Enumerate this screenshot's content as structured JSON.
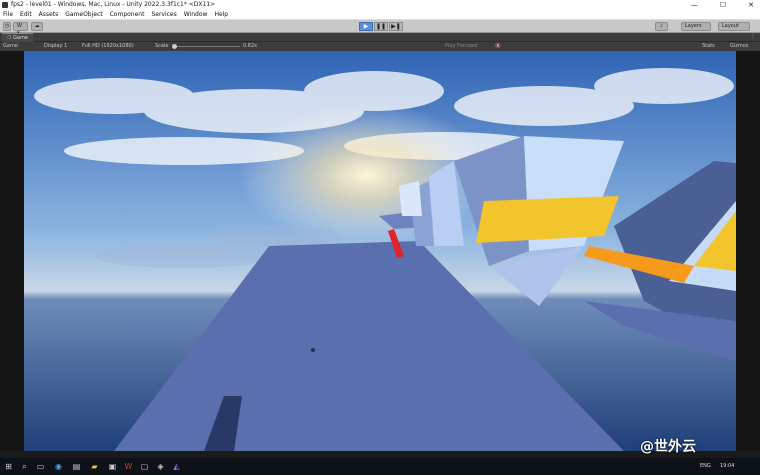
{
  "window": {
    "title": "fps2 - level01 - Windows, Mac, Linux - Unity 2022.3.3f1c1* <DX11>",
    "controls": [
      "—",
      "☐",
      "✕"
    ]
  },
  "menu": [
    "File",
    "Edit",
    "Assets",
    "GameObject",
    "Component",
    "Services",
    "Window",
    "Help"
  ],
  "toolbar": {
    "account_label": "W ▾",
    "cloud_label": "☁",
    "play": "▶",
    "pause": "❚❚",
    "step": "▶❚",
    "layers_label": "Layers",
    "layout_label": "Layout",
    "search_icon": "search-icon"
  },
  "tab": {
    "label": "Game"
  },
  "gamebar": {
    "mode": "Game",
    "display": "Display 1",
    "resolution": "Full HD (1920x1080)",
    "scale_label": "Scale",
    "scale_value": "0.82x",
    "play_focused": "Play Focused",
    "stats": "Stats",
    "gizmos": "Gizmos"
  },
  "taskbar": {
    "lang": "ENG",
    "time": "19:04"
  },
  "watermark": "@世外云",
  "colors": {
    "play_active": "#5b8fd6",
    "sky_top": "#2f63b5",
    "floor": "#5a6fae",
    "yellow_block": "#f2c52c",
    "orange_beam": "#f59a1b",
    "red_marker": "#e0242c"
  }
}
